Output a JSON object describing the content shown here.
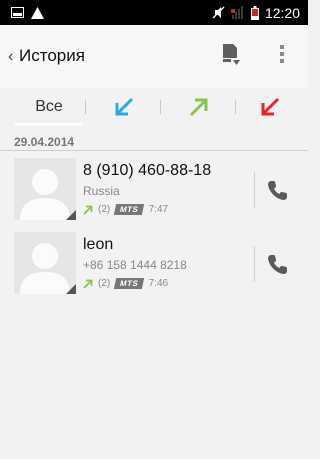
{
  "status_bar": {
    "time": "12:20"
  },
  "header": {
    "title": "История",
    "back_glyph": "‹"
  },
  "tabs": [
    {
      "label": "Все",
      "selected": true,
      "icon": ""
    },
    {
      "label": "",
      "selected": false,
      "icon": "incoming-call-icon"
    },
    {
      "label": "",
      "selected": false,
      "icon": "outgoing-call-icon"
    },
    {
      "label": "",
      "selected": false,
      "icon": "missed-call-icon"
    }
  ],
  "date_header": "29.04.2014",
  "calls": [
    {
      "name": "8 (910) 460-88-18",
      "subtitle": "Russia",
      "count": "(2)",
      "carrier": "MTS",
      "time": "7:47",
      "direction_icon": "outgoing-call-icon"
    },
    {
      "name": "leon",
      "subtitle": "+86 158 1444 8218",
      "count": "(2)",
      "carrier": "MTS",
      "time": "7:46",
      "direction_icon": "outgoing-call-icon"
    }
  ],
  "colors": {
    "incoming": "#29a9e0",
    "outgoing": "#8bc34a",
    "missed": "#e8232a",
    "call_icon": "#5a5a5a"
  }
}
